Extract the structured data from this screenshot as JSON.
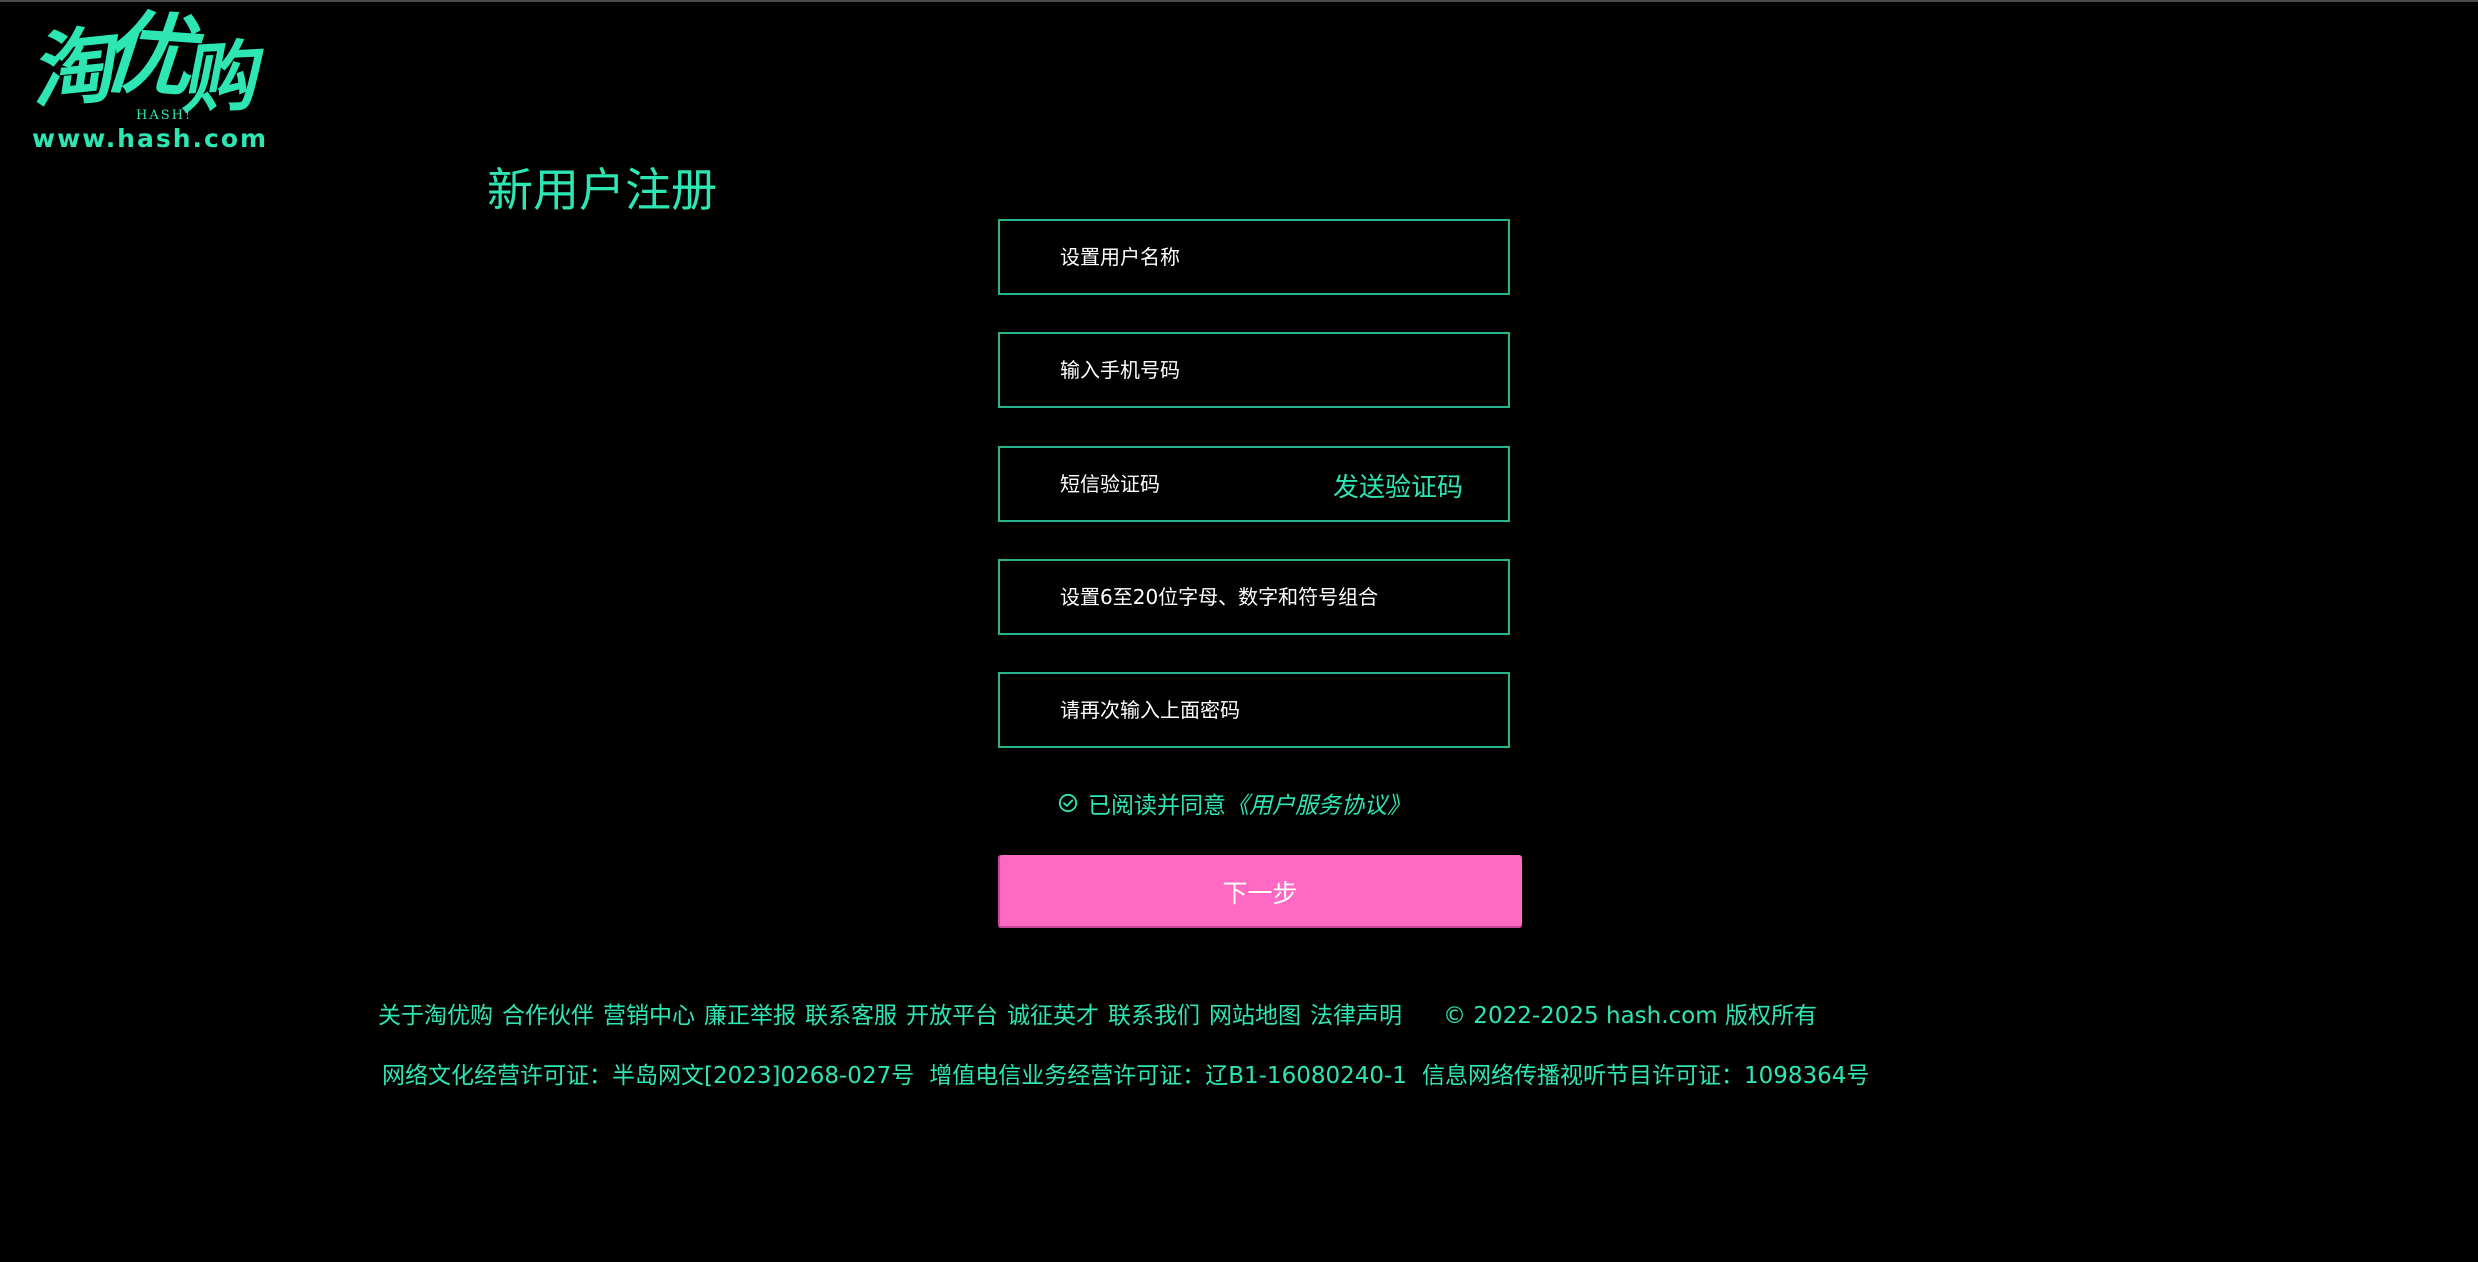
{
  "brand": {
    "logo_chars": [
      "淘",
      "优",
      "购"
    ],
    "logo_sub": "HASH!",
    "logo_url": "www.hash.com",
    "accent_color": "#2ee6b4",
    "button_color": "#ff69c4"
  },
  "page": {
    "title": "新用户注册"
  },
  "form": {
    "username_placeholder": "设置用户名称",
    "phone_placeholder": "输入手机号码",
    "sms_code_placeholder": "短信验证码",
    "send_code_label": "发送验证码",
    "password_placeholder": "设置6至20位字母、数字和符号组合",
    "confirm_password_placeholder": "请再次输入上面密码",
    "agree_text": "已阅读并同意",
    "agreement_link": "《用户服务协议》",
    "agree_icon": "check-circle-icon",
    "next_label": "下一步"
  },
  "footer": {
    "links": [
      "关于淘优购",
      "合作伙伴",
      "营销中心",
      "廉正举报",
      "联系客服",
      "开放平台",
      "诚征英才",
      "联系我们",
      "网站地图",
      "法律声明"
    ],
    "copyright": "© 2022-2025 hash.com 版权所有",
    "licenses": [
      "网络文化经营许可证：半岛网文[2023]0268-027号",
      "增值电信业务经营许可证：辽B1-16080240-1",
      "信息网络传播视听节目许可证：1098364号"
    ]
  }
}
